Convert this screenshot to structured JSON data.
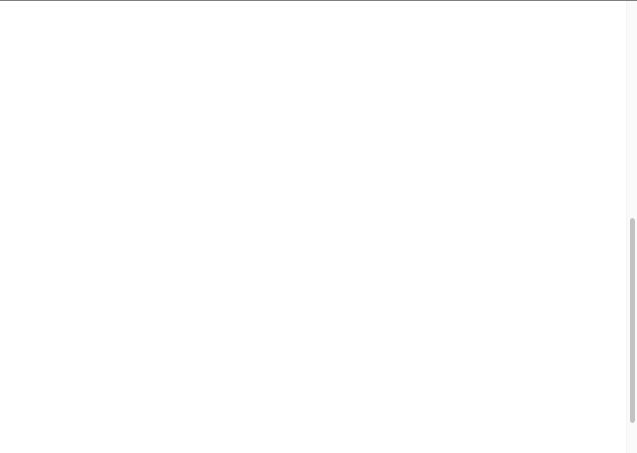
{
  "document": {
    "lines": [
      {
        "text": ""
      },
      {
        "text": ""
      },
      {
        "text": ""
      },
      {
        "text": ""
      },
      {
        "text": ""
      },
      {
        "text": ""
      },
      {
        "text": ""
      },
      {
        "text": ""
      },
      {
        "text": ""
      },
      {
        "text": ""
      }
    ]
  },
  "scrollbar": {
    "position_fraction": 0.48,
    "visible_fraction": 0.45
  }
}
